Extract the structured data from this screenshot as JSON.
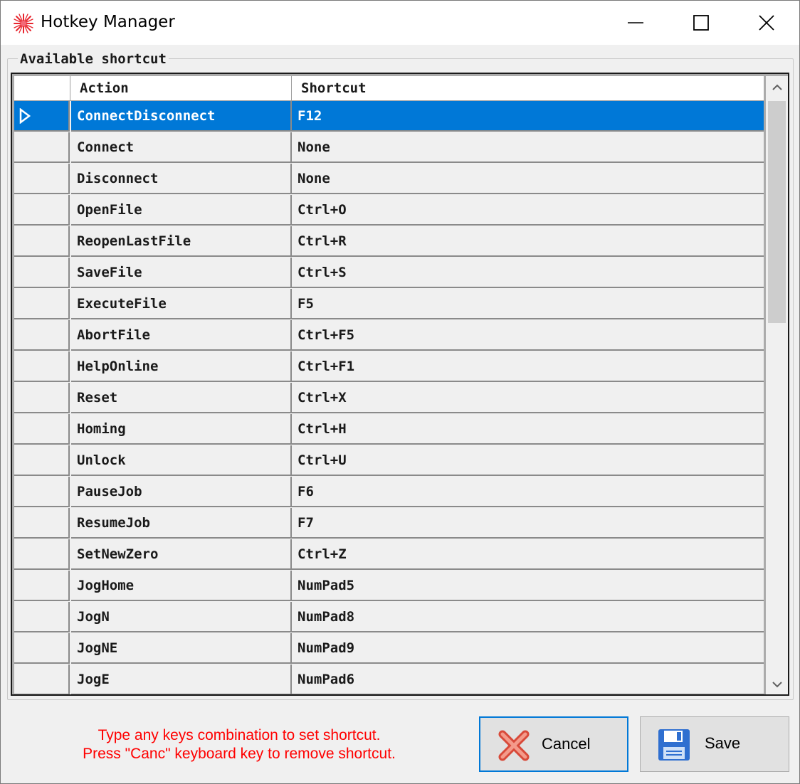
{
  "window": {
    "title": "Hotkey Manager",
    "controls": {
      "minimize": "minimize-icon",
      "maximize": "maximize-icon",
      "close": "close-icon"
    }
  },
  "group": {
    "label": "Available shortcut"
  },
  "grid": {
    "columns": [
      "Action",
      "Shortcut"
    ],
    "selected_index": 0,
    "rows": [
      {
        "action": "ConnectDisconnect",
        "shortcut": "F12"
      },
      {
        "action": "Connect",
        "shortcut": "None"
      },
      {
        "action": "Disconnect",
        "shortcut": "None"
      },
      {
        "action": "OpenFile",
        "shortcut": "Ctrl+O"
      },
      {
        "action": "ReopenLastFile",
        "shortcut": "Ctrl+R"
      },
      {
        "action": "SaveFile",
        "shortcut": "Ctrl+S"
      },
      {
        "action": "ExecuteFile",
        "shortcut": "F5"
      },
      {
        "action": "AbortFile",
        "shortcut": "Ctrl+F5"
      },
      {
        "action": "HelpOnline",
        "shortcut": "Ctrl+F1"
      },
      {
        "action": "Reset",
        "shortcut": "Ctrl+X"
      },
      {
        "action": "Homing",
        "shortcut": "Ctrl+H"
      },
      {
        "action": "Unlock",
        "shortcut": "Ctrl+U"
      },
      {
        "action": "PauseJob",
        "shortcut": "F6"
      },
      {
        "action": "ResumeJob",
        "shortcut": "F7"
      },
      {
        "action": "SetNewZero",
        "shortcut": "Ctrl+Z"
      },
      {
        "action": "JogHome",
        "shortcut": "NumPad5"
      },
      {
        "action": "JogN",
        "shortcut": "NumPad8"
      },
      {
        "action": "JogNE",
        "shortcut": "NumPad9"
      },
      {
        "action": "JogE",
        "shortcut": "NumPad6"
      }
    ]
  },
  "hint": {
    "line1": "Type any keys combination to set shortcut.",
    "line2": "Press \"Canc\" keyboard key to remove shortcut.",
    "color": "#ff0000"
  },
  "buttons": {
    "cancel": {
      "label": "Cancel",
      "icon": "red-x-icon"
    },
    "save": {
      "label": "Save",
      "icon": "floppy-disk-icon"
    }
  },
  "colors": {
    "selection": "#0078d7",
    "accent_border": "#0078d7"
  }
}
